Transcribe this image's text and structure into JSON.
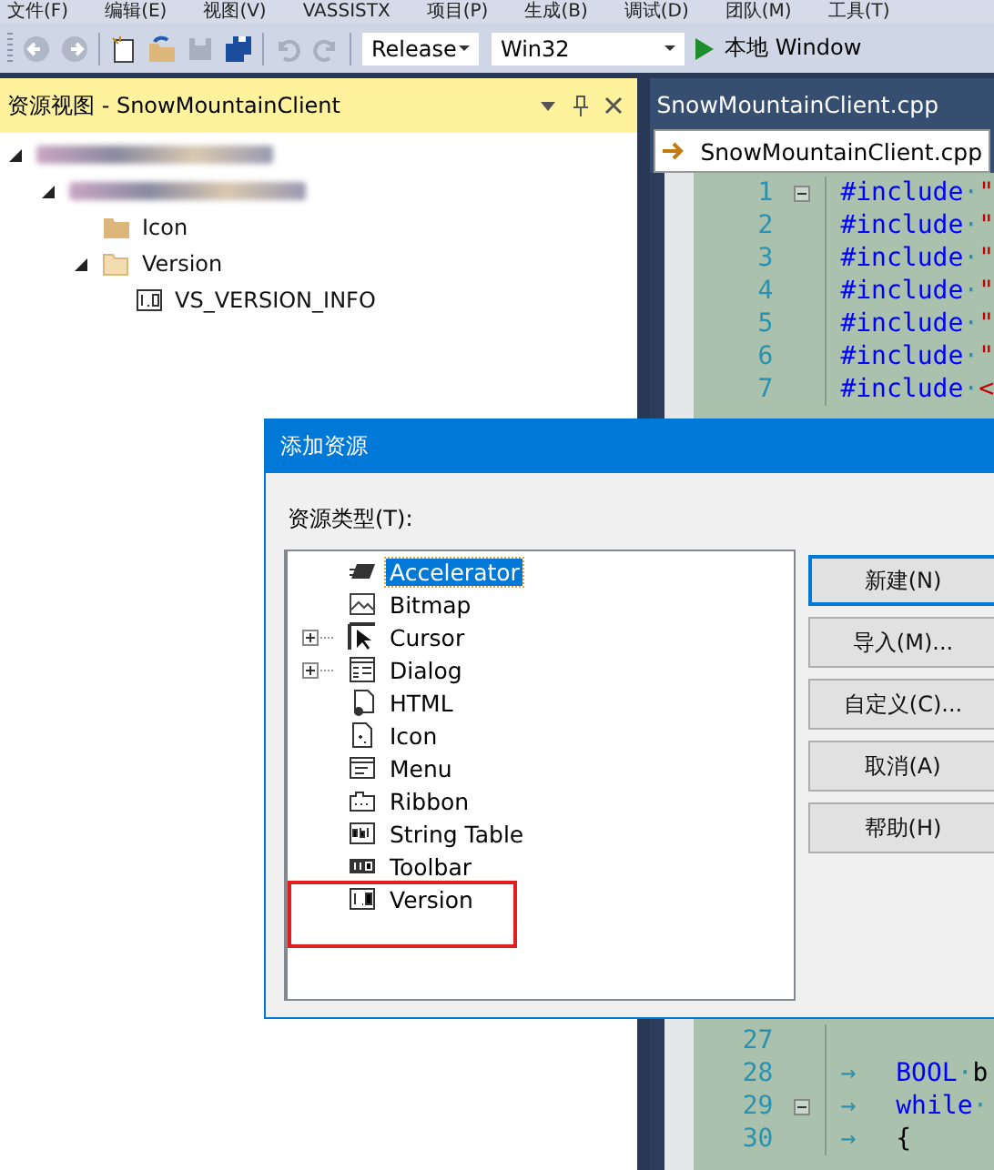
{
  "menu": [
    "文件(F)",
    "编辑(E)",
    "视图(V)",
    "VASSISTX",
    "项目(P)",
    "生成(B)",
    "调试(D)",
    "团队(M)",
    "工具(T)"
  ],
  "toolbar": {
    "config": "Release",
    "platform": "Win32",
    "run_label": "本地 Window"
  },
  "resource_view": {
    "title": "资源视图 - SnowMountainClient",
    "tree": [
      {
        "kind": "redacted",
        "expanded": true,
        "children": [
          {
            "kind": "redacted",
            "expanded": true,
            "children": [
              {
                "kind": "folder",
                "label": "Icon",
                "expanded": false
              },
              {
                "kind": "folder",
                "label": "Version",
                "expanded": true,
                "children": [
                  {
                    "kind": "version",
                    "label": "VS_VERSION_INFO"
                  }
                ]
              }
            ]
          }
        ]
      }
    ]
  },
  "editor": {
    "tab": "SnowMountainClient.cpp",
    "nav": "SnowMountainClient.cpp",
    "lines_top": [
      {
        "number": "1",
        "fold": true,
        "tokens": [
          {
            "kind": "keyword",
            "text": "#include"
          },
          {
            "kind": "space",
            "text": "·"
          },
          {
            "kind": "string",
            "text": "\""
          }
        ]
      },
      {
        "number": "2",
        "fold": false,
        "tokens": [
          {
            "kind": "keyword",
            "text": "#include"
          },
          {
            "kind": "space",
            "text": "·"
          },
          {
            "kind": "string",
            "text": "\""
          }
        ]
      },
      {
        "number": "3",
        "fold": false,
        "tokens": [
          {
            "kind": "keyword",
            "text": "#include"
          },
          {
            "kind": "space",
            "text": "·"
          },
          {
            "kind": "string",
            "text": "\""
          }
        ]
      },
      {
        "number": "4",
        "fold": false,
        "tokens": [
          {
            "kind": "keyword",
            "text": "#include"
          },
          {
            "kind": "space",
            "text": "·"
          },
          {
            "kind": "string",
            "text": "\""
          }
        ]
      },
      {
        "number": "5",
        "fold": false,
        "tokens": [
          {
            "kind": "keyword",
            "text": "#include"
          },
          {
            "kind": "space",
            "text": "·"
          },
          {
            "kind": "string",
            "text": "\""
          }
        ]
      },
      {
        "number": "6",
        "fold": false,
        "tokens": [
          {
            "kind": "keyword",
            "text": "#include"
          },
          {
            "kind": "space",
            "text": "·"
          },
          {
            "kind": "string",
            "text": "\""
          }
        ]
      },
      {
        "number": "7",
        "fold": false,
        "tokens": [
          {
            "kind": "keyword",
            "text": "#include"
          },
          {
            "kind": "space",
            "text": "·"
          },
          {
            "kind": "string",
            "text": "<"
          }
        ]
      }
    ],
    "lines_bottom": [
      {
        "number": "27",
        "fold": false
      },
      {
        "number": "28",
        "fold": false,
        "tokens": [
          {
            "kind": "tab",
            "text": "→"
          },
          {
            "kind": "keyword",
            "text": "BOOL"
          },
          {
            "kind": "space",
            "text": "·"
          },
          {
            "kind": "plain",
            "text": "b"
          }
        ]
      },
      {
        "number": "29",
        "fold": true,
        "tokens": [
          {
            "kind": "tab",
            "text": "→"
          },
          {
            "kind": "keyword",
            "text": "while"
          },
          {
            "kind": "space",
            "text": "·"
          }
        ]
      },
      {
        "number": "30",
        "fold": false,
        "tokens": [
          {
            "kind": "tab",
            "text": "→"
          },
          {
            "kind": "plain",
            "text": "{"
          }
        ]
      }
    ]
  },
  "dialog": {
    "title": "添加资源",
    "list_label": "资源类型(T):",
    "items": [
      {
        "kind": "accelerator",
        "label": "Accelerator",
        "selected": true,
        "expandable": false,
        "highlighted": false
      },
      {
        "kind": "bitmap",
        "label": "Bitmap",
        "selected": false,
        "expandable": false,
        "highlighted": false
      },
      {
        "kind": "cursor",
        "label": "Cursor",
        "selected": false,
        "expandable": true,
        "highlighted": false
      },
      {
        "kind": "dialog",
        "label": "Dialog",
        "selected": false,
        "expandable": true,
        "highlighted": false
      },
      {
        "kind": "html",
        "label": "HTML",
        "selected": false,
        "expandable": false,
        "highlighted": false
      },
      {
        "kind": "icon",
        "label": "Icon",
        "selected": false,
        "expandable": false,
        "highlighted": false
      },
      {
        "kind": "menu",
        "label": "Menu",
        "selected": false,
        "expandable": false,
        "highlighted": false
      },
      {
        "kind": "ribbon",
        "label": "Ribbon",
        "selected": false,
        "expandable": false,
        "highlighted": false
      },
      {
        "kind": "stringtable",
        "label": "String Table",
        "selected": false,
        "expandable": false,
        "highlighted": false
      },
      {
        "kind": "toolbar",
        "label": "Toolbar",
        "selected": false,
        "expandable": false,
        "highlighted": false
      },
      {
        "kind": "version",
        "label": "Version",
        "selected": false,
        "expandable": false,
        "highlighted": true
      }
    ],
    "buttons": [
      {
        "label": "新建(N)",
        "default": true
      },
      {
        "label": "导入(M)...",
        "default": false
      },
      {
        "label": "自定义(C)...",
        "default": false
      },
      {
        "label": "取消(A)",
        "default": false
      },
      {
        "label": "帮助(H)",
        "default": false
      }
    ]
  }
}
